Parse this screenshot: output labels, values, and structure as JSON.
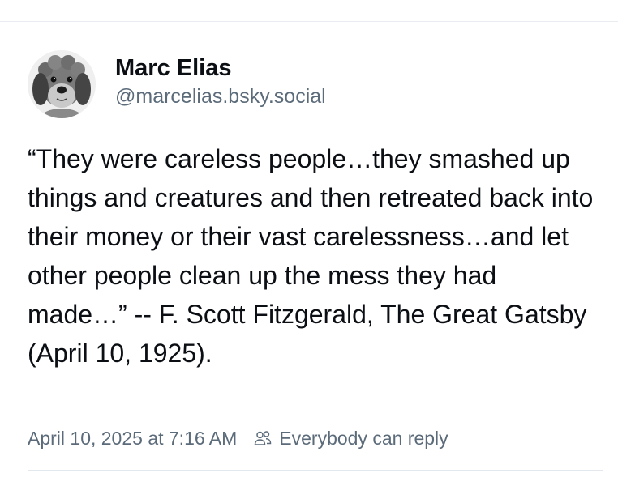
{
  "author": {
    "display_name": "Marc Elias",
    "handle": "@marcelias.bsky.social",
    "avatar": "dog-portrait-avatar"
  },
  "post": {
    "text": "“They were careless people…they smashed up things and creatures and then retreated back into their money or their vast carelessness…and let other people clean up the mess they had made…” -- F. Scott Fitzgerald, The Great Gatsby (April 10, 1925).",
    "timestamp": "April 10, 2025 at 7:16 AM",
    "reply_setting": "Everybody can reply",
    "reply_icon": "people-icon"
  },
  "colors": {
    "text_primary": "#0b0f14",
    "text_secondary": "#5c6b7a",
    "divider": "#e9edf1",
    "background": "#ffffff"
  }
}
